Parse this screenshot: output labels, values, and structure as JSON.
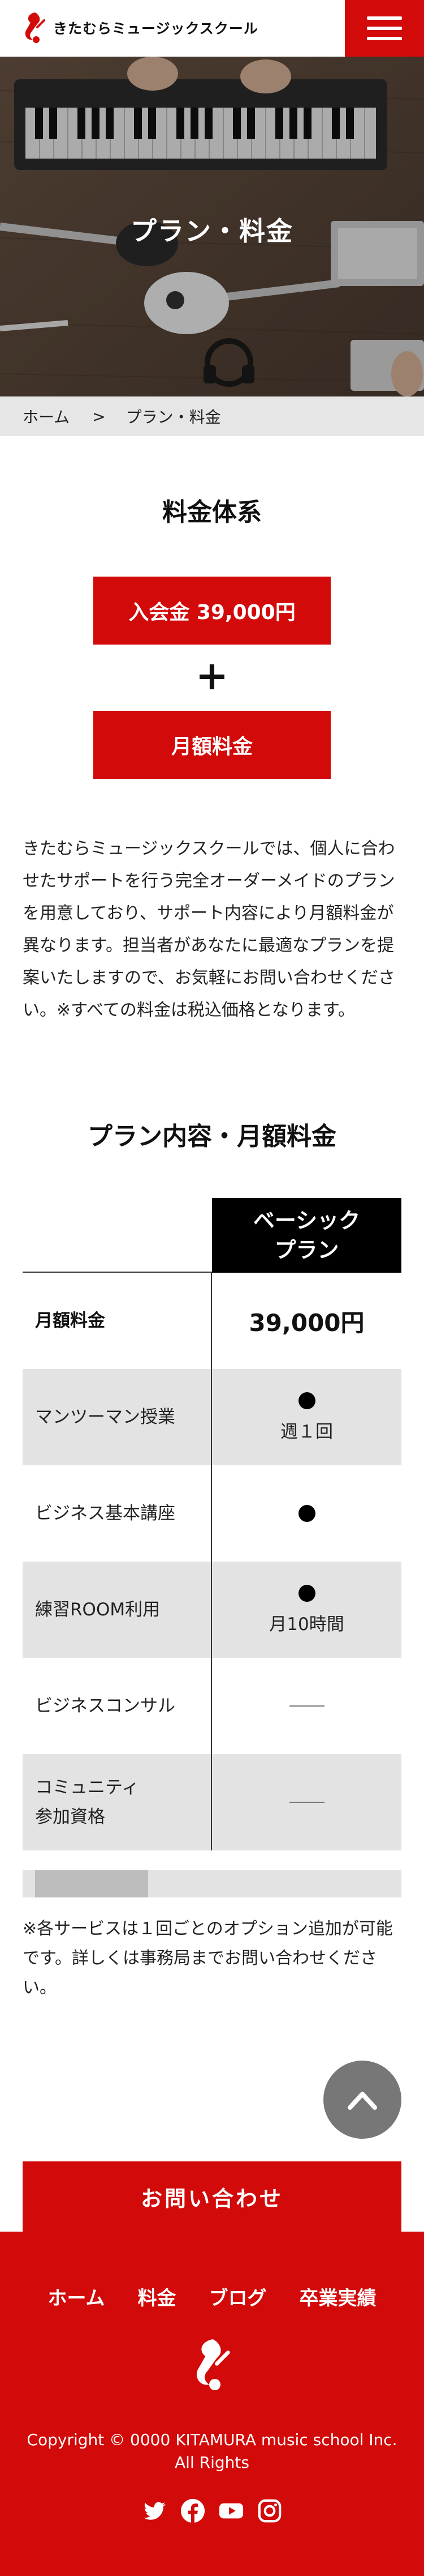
{
  "header": {
    "brand": "きたむらミュージックスクール",
    "menu_icon": "hamburger-icon"
  },
  "hero": {
    "title": "プラン・料金"
  },
  "breadcrumb": {
    "home": "ホーム",
    "separator": ">",
    "current": "プラン・料金"
  },
  "fee_system": {
    "title": "料金体系",
    "enrollment_label": "入会金 39,000円",
    "plus": "+",
    "monthly_label": "月額料金",
    "description": "きたむらミュージックスクールでは、個人に合わせたサポートを行う完全オーダーメイドのプランを用意しており、サポート内容により月額料金が異なります。担当者があなたに最適なプランを提案いたしますので、お気軽にお問い合わせください。※すべての料金は税込価格となります。"
  },
  "plan_table": {
    "title": "プラン内容・月額料金",
    "plan_name": "ベーシック\nプラン",
    "rows": [
      {
        "label": "月額料金",
        "value": "39,000円",
        "marker": "text"
      },
      {
        "label": "マンツーマン授業",
        "value": "週１回",
        "marker": "dot"
      },
      {
        "label": "ビジネス基本講座",
        "value": "",
        "marker": "dot"
      },
      {
        "label": "練習ROOM利用",
        "value": "月10時間",
        "marker": "dot"
      },
      {
        "label": "ビジネスコンサル",
        "value": "",
        "marker": "dash"
      },
      {
        "label": "コミュニティ\n参加資格",
        "value": "",
        "marker": "dash"
      }
    ],
    "note": "※各サービスは１回ごとのオプション追加が可能です。詳しくは事務局までお問い合わせください。"
  },
  "contact": {
    "label": "お問い合わせ"
  },
  "footer": {
    "nav": [
      "ホーム",
      "料金",
      "ブログ",
      "卒業実績"
    ],
    "copyright_line1": "Copyright © 0000 KITAMURA music school Inc.",
    "copyright_line2": "All Rights",
    "social_icons": [
      "twitter-icon",
      "facebook-icon",
      "youtube-icon",
      "instagram-icon"
    ]
  },
  "colors": {
    "brand_red": "#d20a0a",
    "table_gray": "#e3e3e3",
    "header_black": "#000000"
  }
}
